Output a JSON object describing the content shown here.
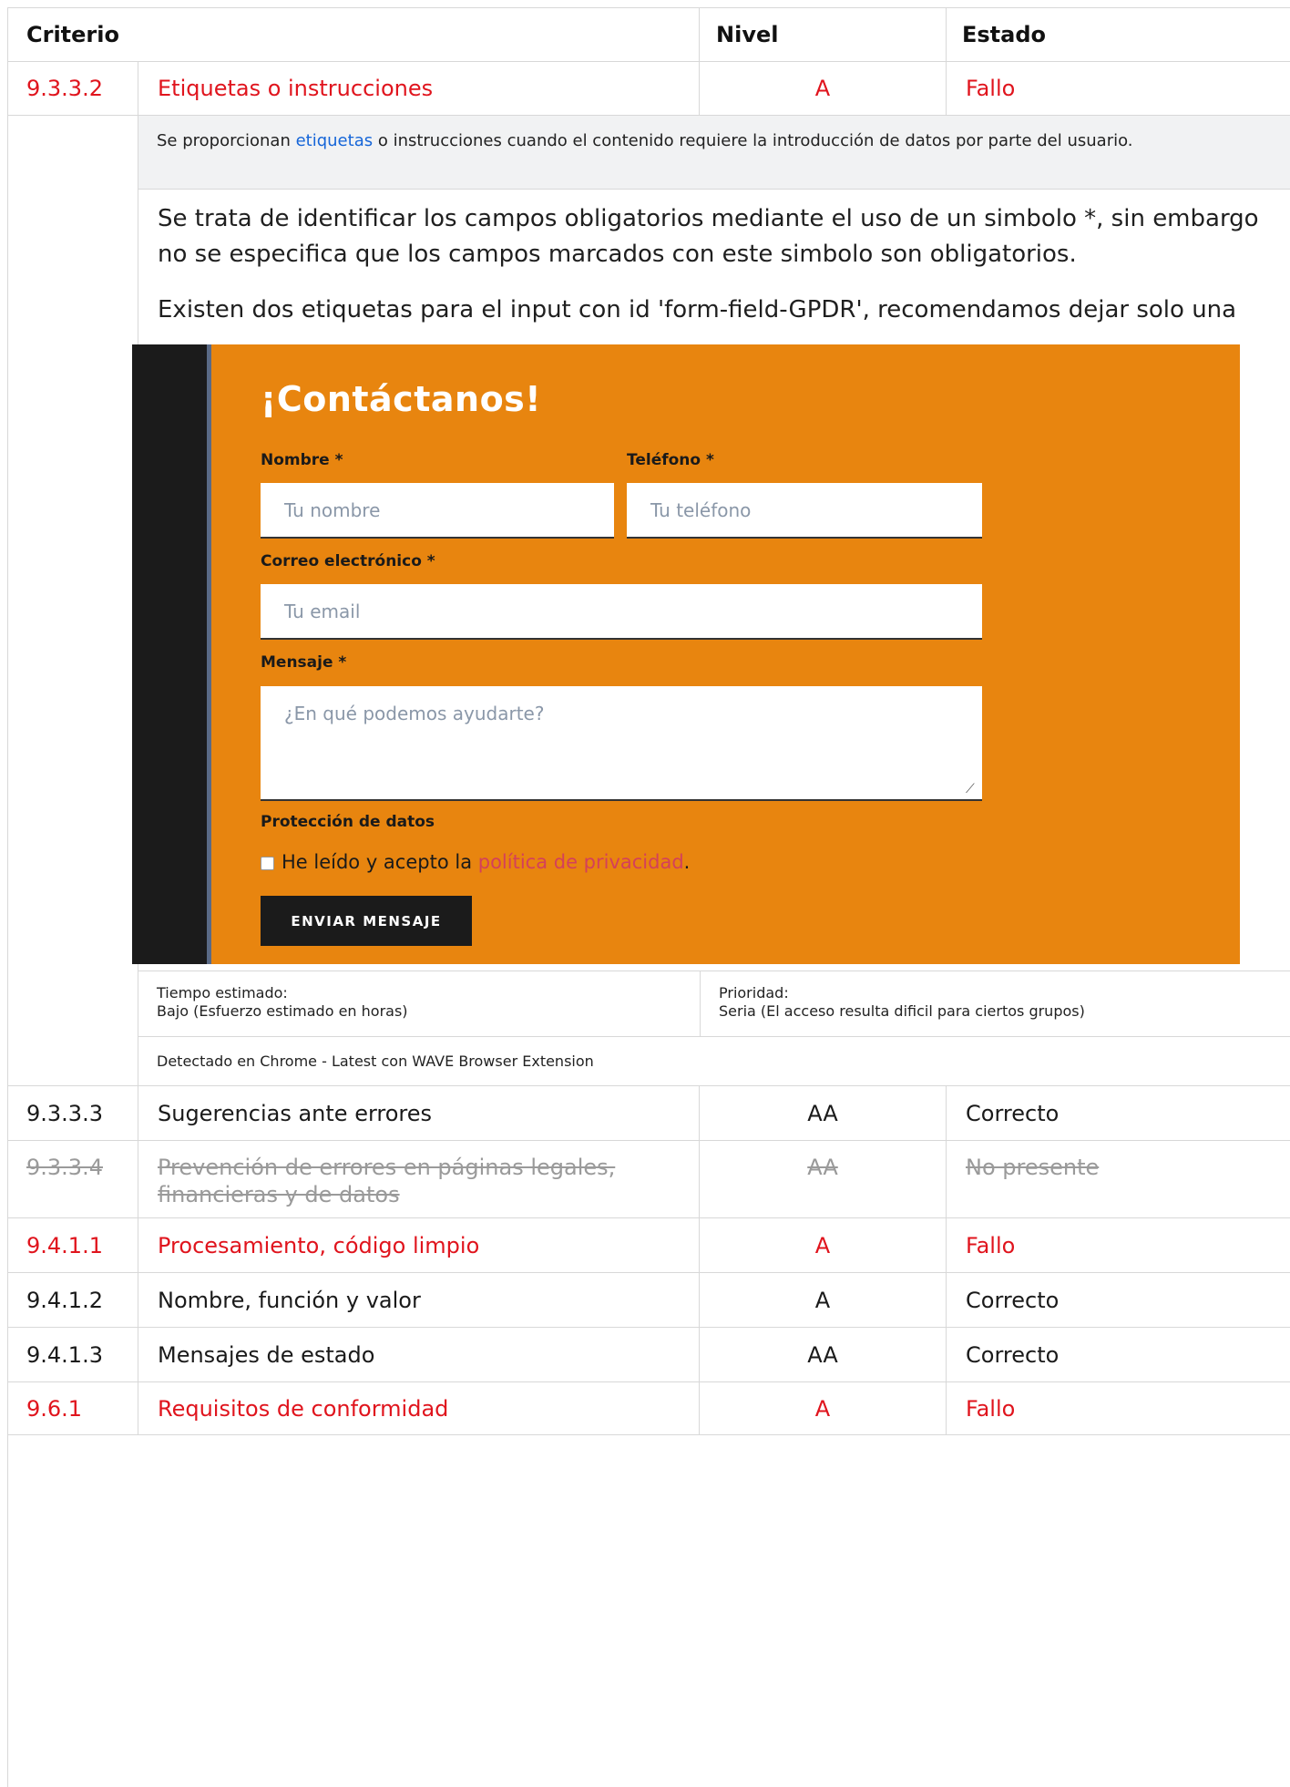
{
  "header": {
    "criterio": "Criterio",
    "nivel": "Nivel",
    "estado": "Estado"
  },
  "expanded": {
    "code": "9.3.3.2",
    "name": "Etiquetas o instrucciones",
    "level": "A",
    "state": "Fallo",
    "description_pre": "Se proporcionan ",
    "description_link": "etiquetas",
    "description_post": " o instrucciones cuando el contenido requiere la introducción de datos por parte del usuario.",
    "paragraph1": "Se trata de identificar los campos obligatorios mediante el uso de un simbolo *, sin embargo no se especifica que los campos marcados con este simbolo son obligatorios.",
    "paragraph2": "Existen dos etiquetas para el input con id 'form-field-GPDR', recomendamos dejar solo una",
    "form": {
      "title": "¡Contáctanos!",
      "name_label": "Nombre *",
      "name_placeholder": "Tu nombre",
      "phone_label": "Teléfono *",
      "phone_placeholder": "Tu teléfono",
      "email_label": "Correo electrónico *",
      "email_placeholder": "Tu email",
      "message_label": "Mensaje *",
      "message_placeholder": "¿En qué podemos ayudarte?",
      "privacy_heading": "Protección de datos",
      "accept_pre": "He leído y acepto la ",
      "accept_link": "política de privacidad",
      "accept_post": ".",
      "send_button": "ENVIAR MENSAJE",
      "colors": {
        "background": "#e8850f",
        "sidebar": "#1b1b1b",
        "link": "#d4405a"
      }
    },
    "time_label": "Tiempo estimado:",
    "time_value": "Bajo (Esfuerzo estimado en horas)",
    "priority_label": "Prioridad:",
    "priority_value": "Seria (El acceso resulta dificil para ciertos grupos)",
    "detected": "Detectado en Chrome - Latest con WAVE Browser Extension"
  },
  "rows": [
    {
      "code": "9.3.3.3",
      "name": "Sugerencias ante errores",
      "level": "AA",
      "state": "Correcto",
      "status": "pass"
    },
    {
      "code": "9.3.3.4",
      "name": "Prevención de errores en páginas legales, financieras y de datos",
      "level": "AA",
      "state": "No presente",
      "status": "na"
    },
    {
      "code": "9.4.1.1",
      "name": "Procesamiento, código limpio",
      "level": "A",
      "state": "Fallo",
      "status": "fail"
    },
    {
      "code": "9.4.1.2",
      "name": "Nombre, función y valor",
      "level": "A",
      "state": "Correcto",
      "status": "pass"
    },
    {
      "code": "9.4.1.3",
      "name": "Mensajes de estado",
      "level": "AA",
      "state": "Correcto",
      "status": "pass"
    },
    {
      "code": "9.6.1",
      "name": "Requisitos de conformidad",
      "level": "A",
      "state": "Fallo",
      "status": "fail"
    }
  ],
  "colors": {
    "fail": "#e0141d",
    "link": "#1565d8",
    "na": "#9a9a9a",
    "description_bg": "#f1f2f3"
  }
}
